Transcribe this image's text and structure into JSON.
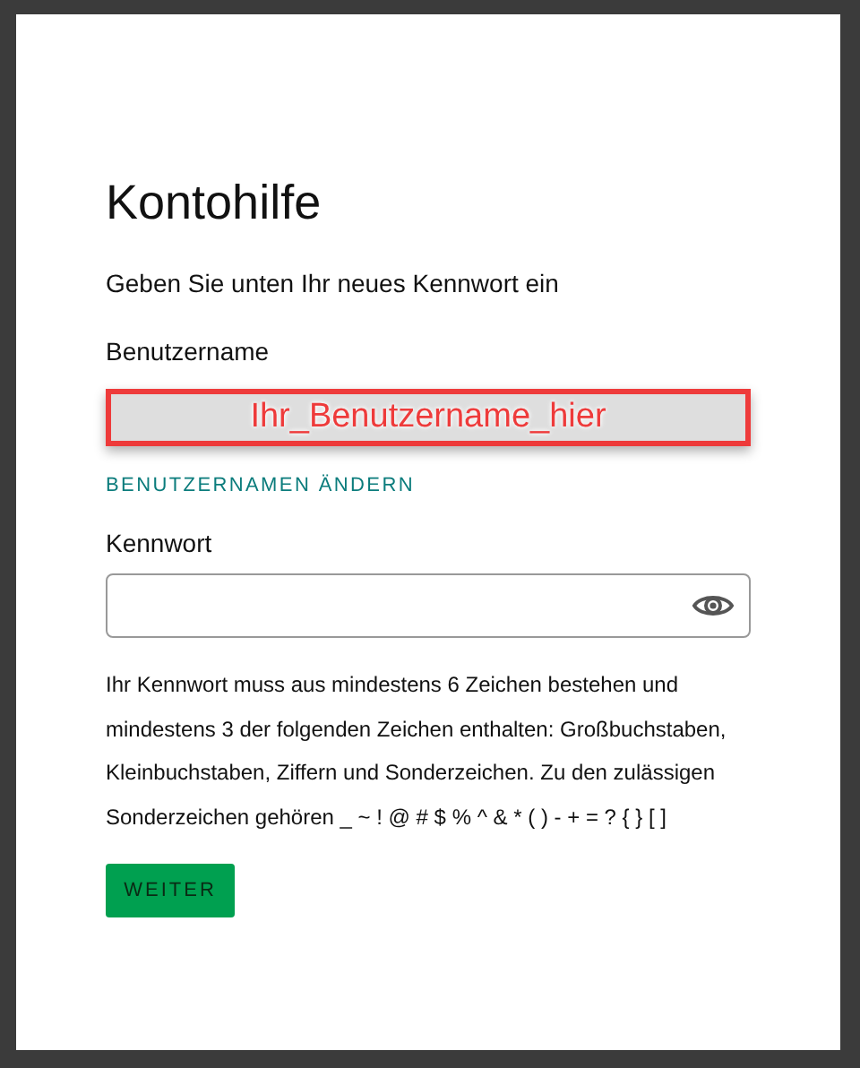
{
  "title": "Kontohilfe",
  "subtitle": "Geben Sie unten Ihr neues Kennwort ein",
  "username": {
    "label": "Benutzername",
    "value": "Ihr_Benutzername_hier",
    "annotated": true
  },
  "change_username_link": "BENUTZERNAMEN ÄNDERN",
  "password": {
    "label": "Kennwort",
    "show_password_toggle": true
  },
  "rules": "Ihr Kennwort muss aus mindestens 6 Zeichen bestehen und mindestens 3 der folgenden Zeichen enthalten: Großbuchstaben, Kleinbuchstaben, Ziffern und Sonderzeichen. Zu den zulässigen Sonderzeichen gehören _ ~ ! @ # $ % ^ & * ( ) - + = ? { } [ ]",
  "button": "WEITER"
}
